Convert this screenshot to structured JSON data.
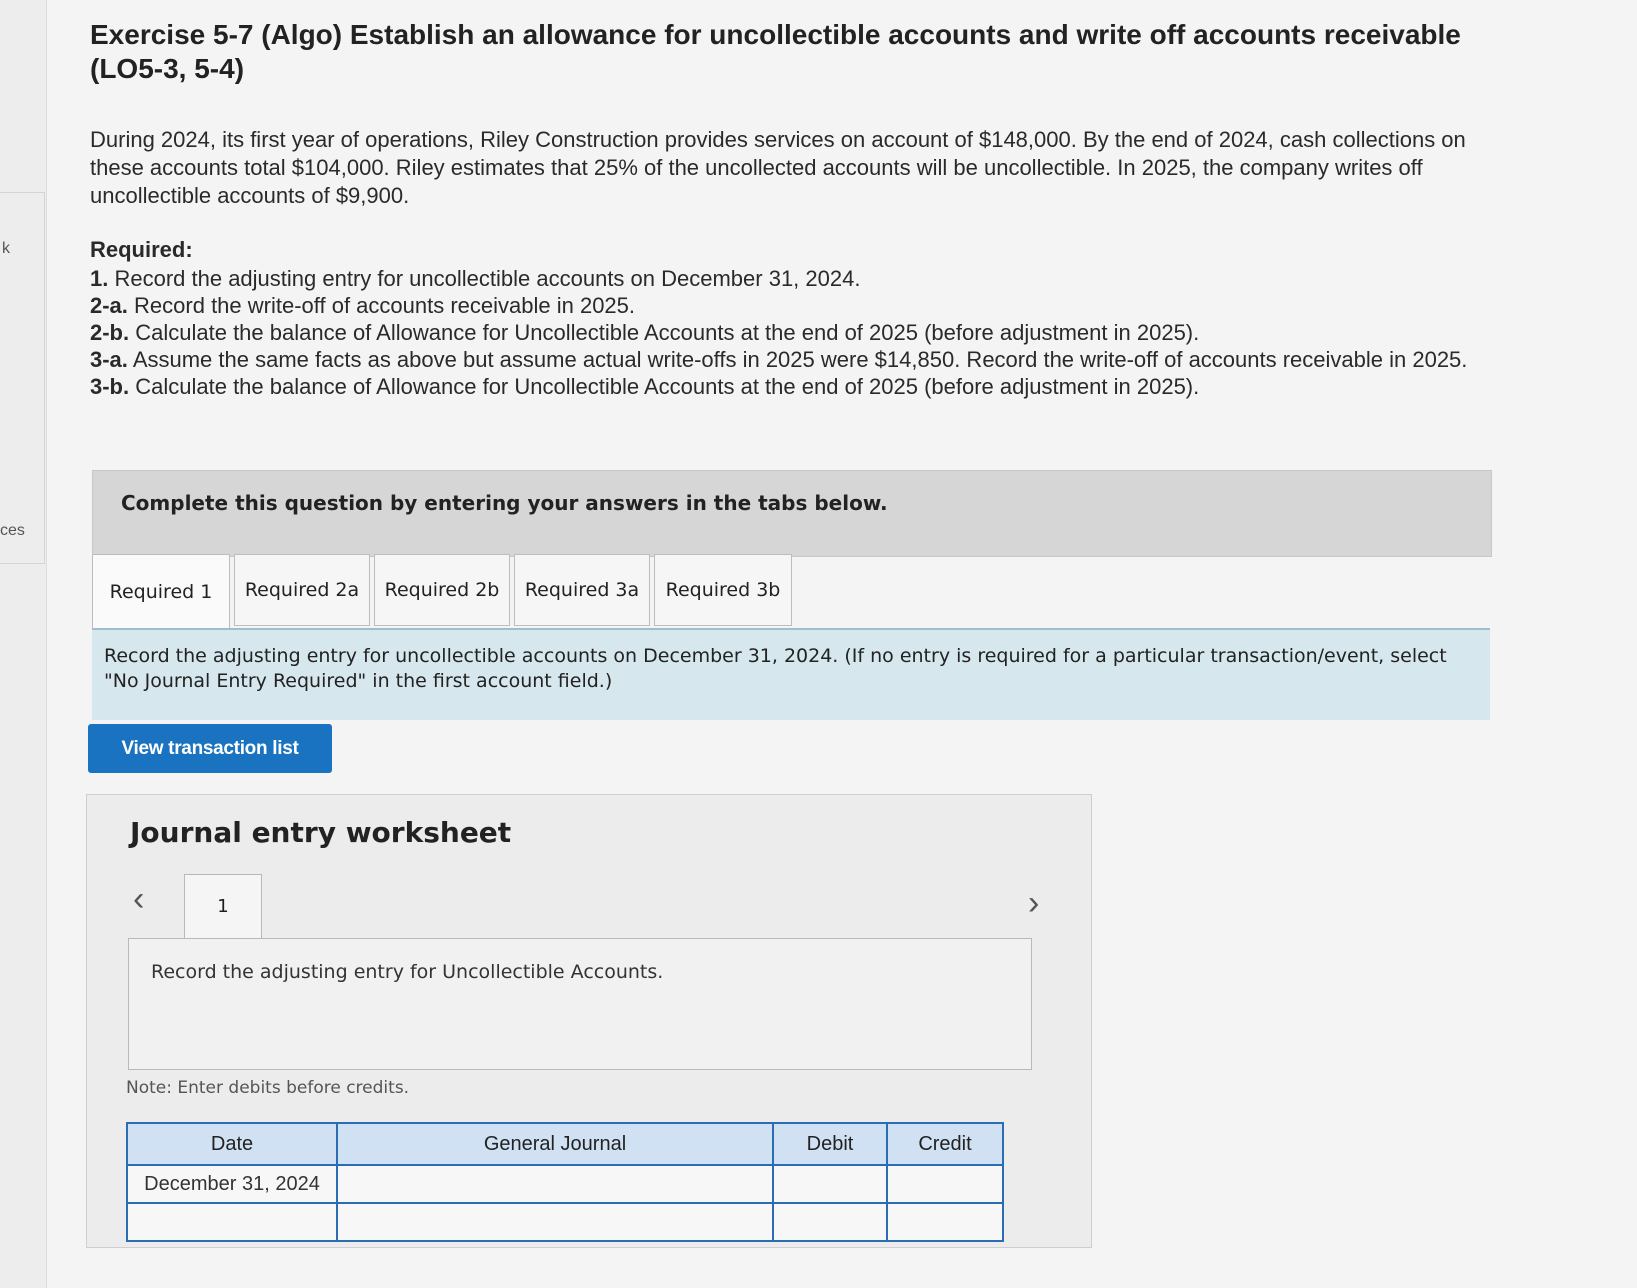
{
  "sidebar": {
    "fragment_1": "k",
    "fragment_2": "ces"
  },
  "exercise": {
    "title": "Exercise 5-7 (Algo) Establish an allowance for uncollectible accounts and write off accounts receivable (LO5-3, 5-4)",
    "problem_text": "During 2024, its first year of operations, Riley Construction provides services on account of $148,000. By the end of 2024, cash collections on these accounts total $104,000. Riley estimates that 25% of the uncollected accounts will be uncollectible. In 2025, the company writes off uncollectible accounts of $9,900.",
    "required_heading": "Required:",
    "requirements": [
      {
        "label": "1.",
        "text": " Record the adjusting entry for uncollectible accounts on December 31, 2024."
      },
      {
        "label": "2-a.",
        "text": " Record the write-off of accounts receivable in 2025."
      },
      {
        "label": "2-b.",
        "text": " Calculate the balance of Allowance for Uncollectible Accounts at the end of 2025 (before adjustment in 2025)."
      },
      {
        "label": "3-a.",
        "text": " Assume the same facts as above but assume actual write-offs in 2025 were $14,850. Record the write-off of accounts receivable in 2025."
      },
      {
        "label": "3-b.",
        "text": " Calculate the balance of Allowance for Uncollectible Accounts at the end of 2025 (before adjustment in 2025)."
      }
    ]
  },
  "instructions": "Complete this question by entering your answers in the tabs below.",
  "tabs": [
    {
      "label": "Required 1"
    },
    {
      "label": "Required 2a"
    },
    {
      "label": "Required 2b"
    },
    {
      "label": "Required 3a"
    },
    {
      "label": "Required 3b"
    }
  ],
  "prompt": "Record the adjusting entry for uncollectible accounts on December 31, 2024. (If no entry is required for a particular transaction/event, select \"No Journal Entry Required\" in the first account field.)",
  "view_button": "View transaction list",
  "worksheet": {
    "title": "Journal entry worksheet",
    "entry_number": "1",
    "entry_description": "Record the adjusting entry for Uncollectible Accounts.",
    "note": "Note: Enter debits before credits.",
    "columns": {
      "date": "Date",
      "journal": "General Journal",
      "debit": "Debit",
      "credit": "Credit"
    },
    "rows": [
      {
        "date": "December 31, 2024",
        "account": "",
        "debit": "",
        "credit": ""
      },
      {
        "date": "",
        "account": "",
        "debit": "",
        "credit": ""
      }
    ]
  }
}
